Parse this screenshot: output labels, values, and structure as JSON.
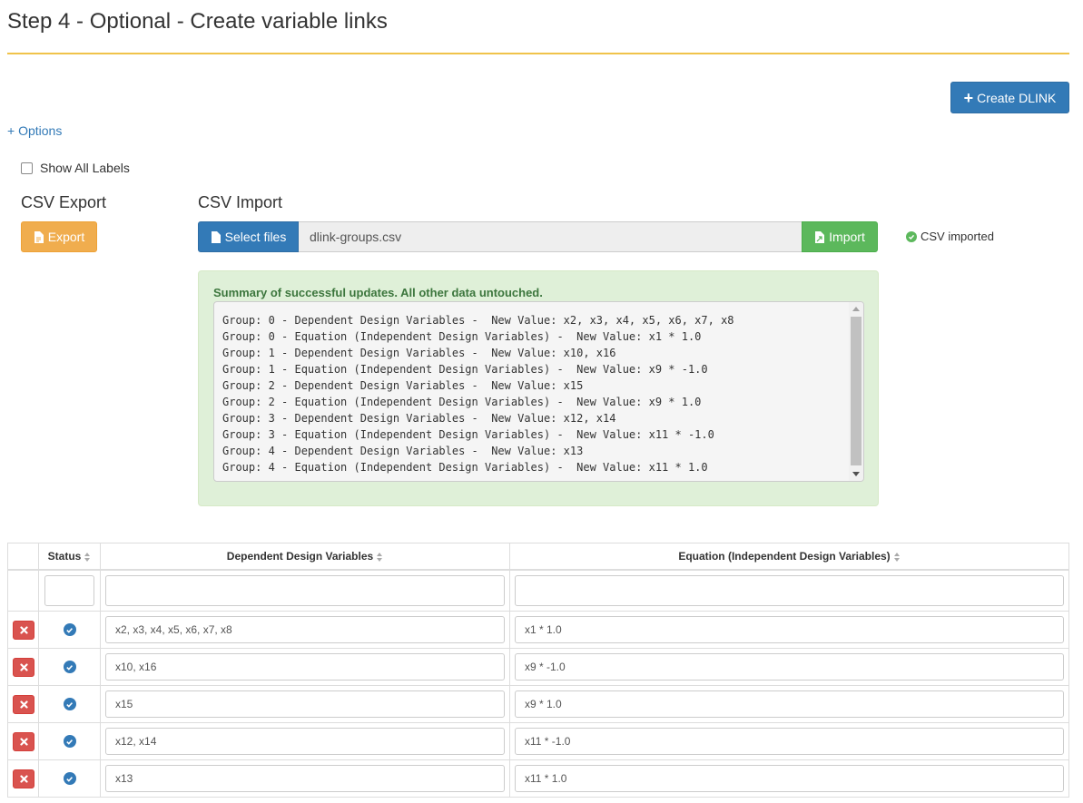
{
  "header": {
    "title": "Step 4 - Optional - Create variable links"
  },
  "toolbar": {
    "create_label": "Create DLINK",
    "options_label": "+ Options"
  },
  "options": {
    "show_all_labels": "Show All Labels",
    "show_all_labels_checked": false
  },
  "csv_export": {
    "heading": "CSV Export",
    "button_label": "Export"
  },
  "csv_import": {
    "heading": "CSV Import",
    "select_label": "Select files",
    "file_name": "dlink-groups.csv",
    "import_label": "Import",
    "status": "CSV imported"
  },
  "summary": {
    "title": "Summary of successful updates. All other data untouched.",
    "lines": [
      "Group: 0 - Dependent Design Variables -  New Value: x2, x3, x4, x5, x6, x7, x8",
      "Group: 0 - Equation (Independent Design Variables) -  New Value: x1 * 1.0",
      "Group: 1 - Dependent Design Variables -  New Value: x10, x16",
      "Group: 1 - Equation (Independent Design Variables) -  New Value: x9 * -1.0",
      "Group: 2 - Dependent Design Variables -  New Value: x15",
      "Group: 2 - Equation (Independent Design Variables) -  New Value: x9 * 1.0",
      "Group: 3 - Dependent Design Variables -  New Value: x12, x14",
      "Group: 3 - Equation (Independent Design Variables) -  New Value: x11 * -1.0",
      "Group: 4 - Dependent Design Variables -  New Value: x13",
      "Group: 4 - Equation (Independent Design Variables) -  New Value: x11 * 1.0"
    ]
  },
  "table": {
    "columns": [
      "",
      "Status",
      "Dependent Design Variables",
      "Equation (Independent Design Variables)"
    ],
    "filters": {
      "status": "",
      "dependent": "",
      "equation": ""
    },
    "rows": [
      {
        "dependent": "x2, x3, x4, x5, x6, x7, x8",
        "equation": "x1 * 1.0"
      },
      {
        "dependent": "x10, x16",
        "equation": "x9 * -1.0"
      },
      {
        "dependent": "x15",
        "equation": "x9 * 1.0"
      },
      {
        "dependent": "x12, x14",
        "equation": "x11 * -1.0"
      },
      {
        "dependent": "x13",
        "equation": "x11 * 1.0"
      }
    ]
  },
  "icons": {
    "create": "plus-icon",
    "export": "file-export-icon",
    "select": "file-icon",
    "import": "file-import-icon",
    "status_ok": "check-circle-icon",
    "delete": "remove-icon"
  },
  "colors": {
    "primary": "#337ab7",
    "warning": "#f0ad4e",
    "success": "#5cb85c",
    "danger": "#d9534f",
    "title_rule": "#f0c34a",
    "summary_bg": "#dff0d8",
    "summary_text": "#3c763d"
  }
}
